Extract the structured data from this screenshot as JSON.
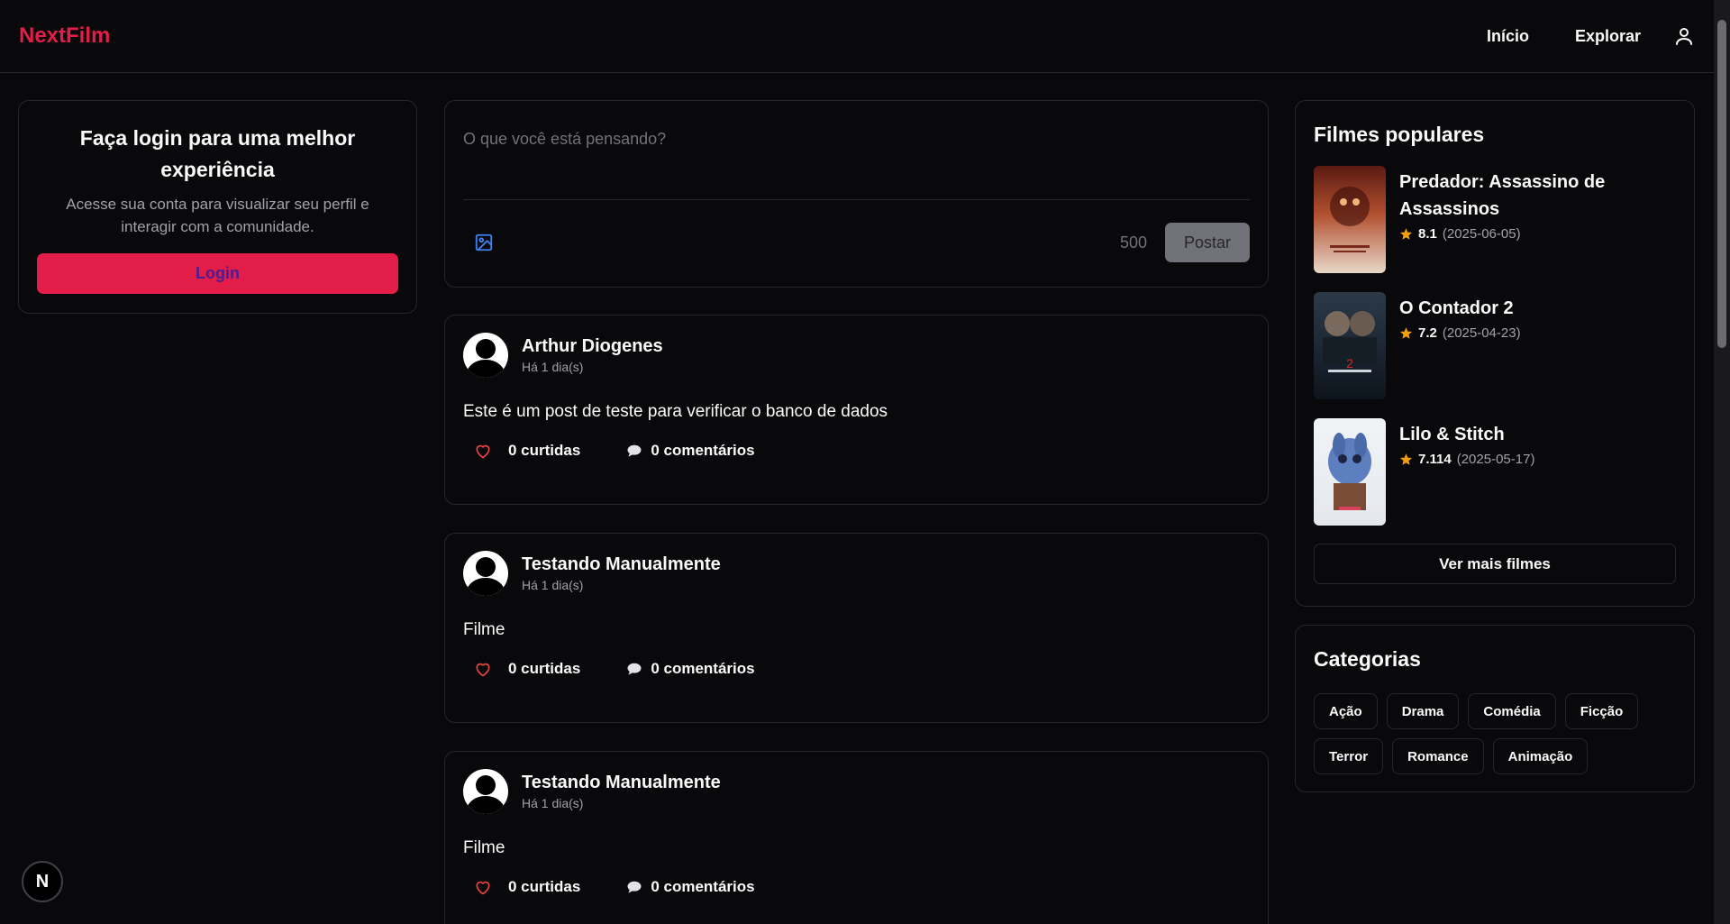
{
  "app": {
    "logo": "NextFilm"
  },
  "nav": {
    "home": "Início",
    "explore": "Explorar",
    "user_icon": "user-icon"
  },
  "login_card": {
    "title": "Faça login para uma melhor experiência",
    "subtitle": "Acesse sua conta para visualizar seu perfil e interagir com a comunidade.",
    "button": "Login"
  },
  "composer": {
    "placeholder": "O que você está pensando?",
    "char_count": "500",
    "post_button": "Postar",
    "image_icon": "image-icon"
  },
  "posts": [
    {
      "author": "Arthur Diogenes",
      "time": "Há 1 dia(s)",
      "body": "Este é um post de teste para verificar o banco de dados",
      "likes": "0 curtidas",
      "comments": "0 comentários"
    },
    {
      "author": "Testando Manualmente",
      "time": "Há 1 dia(s)",
      "body": "Filme",
      "likes": "0 curtidas",
      "comments": "0 comentários"
    },
    {
      "author": "Testando Manualmente",
      "time": "Há 1 dia(s)",
      "body": "Filme",
      "likes": "0 curtidas",
      "comments": "0 comentários"
    }
  ],
  "popular": {
    "title": "Filmes populares",
    "movies": [
      {
        "title": "Predador: Assassino de Assassinos",
        "rating": "8.1",
        "date": "(2025-06-05)"
      },
      {
        "title": "O Contador 2",
        "rating": "7.2",
        "date": "(2025-04-23)"
      },
      {
        "title": "Lilo & Stitch",
        "rating": "7.114",
        "date": "(2025-05-17)"
      }
    ],
    "more_button": "Ver mais filmes"
  },
  "categories": {
    "title": "Categorias",
    "items": [
      "Ação",
      "Drama",
      "Comédia",
      "Ficção",
      "Terror",
      "Romance",
      "Animação"
    ]
  },
  "fab": {
    "label": "N"
  },
  "colors": {
    "brand": "#e11d48",
    "background": "#09090b",
    "border": "#27272a",
    "star": "#f59e0b",
    "heart": "#ef4444"
  }
}
